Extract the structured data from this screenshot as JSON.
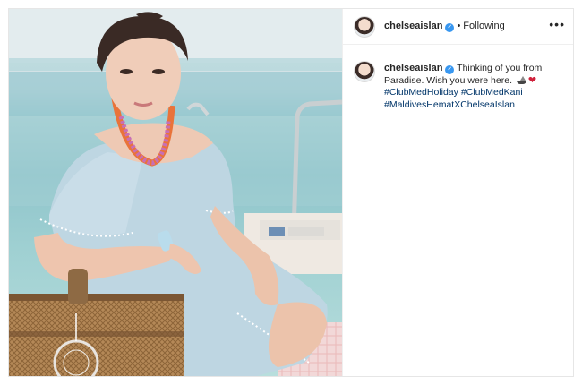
{
  "post": {
    "username": "chelseaislan",
    "verified": true,
    "separator": "•",
    "follow_status": "Following",
    "more_icon": "more-options-icon",
    "photo_description_icon": "post-photo"
  },
  "caption": {
    "username": "chelseaislan",
    "text": "Thinking of you from Paradise. Wish you were here.",
    "emojis": [
      "boat-icon",
      "heart-icon"
    ],
    "hashtags": [
      "#ClubMedHoliday",
      "#ClubMedKani",
      "#MaldivesHematXChelseaIslan"
    ]
  },
  "colors": {
    "link": "#003569",
    "verified": "#3897f0",
    "text": "#262626"
  }
}
